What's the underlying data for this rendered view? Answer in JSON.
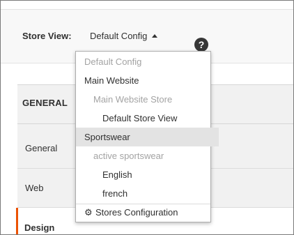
{
  "store_view": {
    "label": "Store View:",
    "current": "Default Config",
    "help_glyph": "?"
  },
  "dropdown": {
    "items": [
      {
        "label": "Default Config",
        "state": "disabled"
      },
      {
        "label": "Main Website",
        "state": "enabled"
      },
      {
        "label": "Main Website Store",
        "state": "disabled"
      },
      {
        "label": "Default Store View",
        "state": "enabled"
      },
      {
        "label": "Sportswear",
        "state": "enabled",
        "highlighted": true
      },
      {
        "label": "active sportswear",
        "state": "disabled"
      },
      {
        "label": "English",
        "state": "enabled"
      },
      {
        "label": "french",
        "state": "enabled"
      }
    ],
    "footer_label": "Stores Configuration",
    "footer_icon": "gear-icon"
  },
  "config_nav": {
    "section_title": "GENERAL",
    "items": [
      {
        "label": "General"
      },
      {
        "label": "Web"
      },
      {
        "label": "Design",
        "active": true
      }
    ]
  },
  "colors": {
    "active_accent": "#eb5202",
    "panel_background": "#f1f1f1",
    "store_bar_background": "#f8f8f8",
    "highlight_background": "#e3e3e3",
    "disabled_text": "#a3a3a3"
  }
}
